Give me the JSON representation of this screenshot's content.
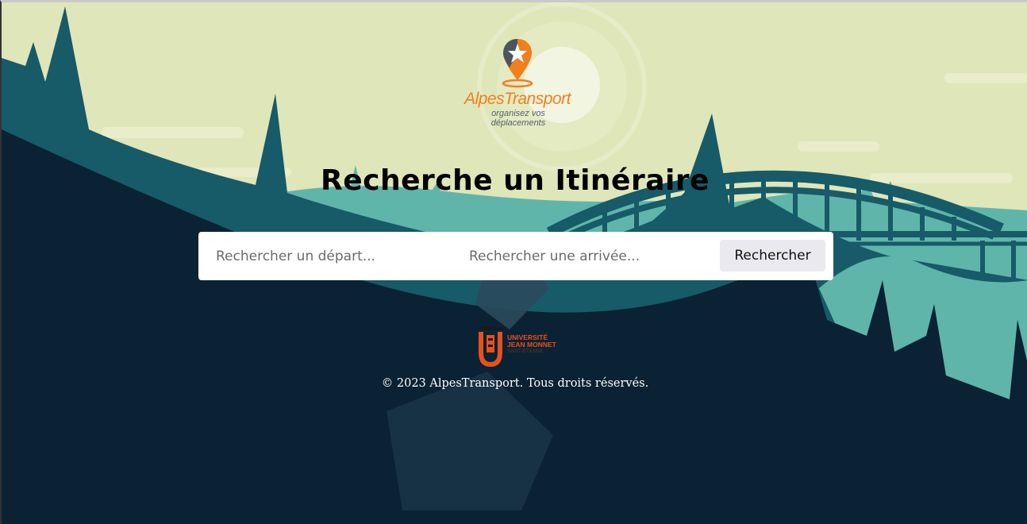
{
  "brand": {
    "name": "AlpesTransport",
    "tagline": "organisez vos déplacements",
    "logo_icon": "map-pin-star-icon"
  },
  "page_title": "Recherche un Itinéraire",
  "search": {
    "departure_placeholder": "Rechercher un départ...",
    "departure_value": "",
    "arrival_placeholder": "Rechercher une arrivée...",
    "arrival_value": "",
    "button_label": "Rechercher"
  },
  "partner": {
    "name_line1": "UNIVERSITÉ",
    "name_line2": "JEAN MONNET",
    "name_line3": "SAINT-ÉTIENNE"
  },
  "footer": {
    "copyright": "© 2023 AlpesTransport. Tous droits réservés."
  },
  "colors": {
    "sky": "#dfe6b9",
    "dark_navy": "#0a2233",
    "teal_hills": "#175a68",
    "light_teal": "#5fb5aa",
    "brand_orange": "#f07f1e"
  }
}
